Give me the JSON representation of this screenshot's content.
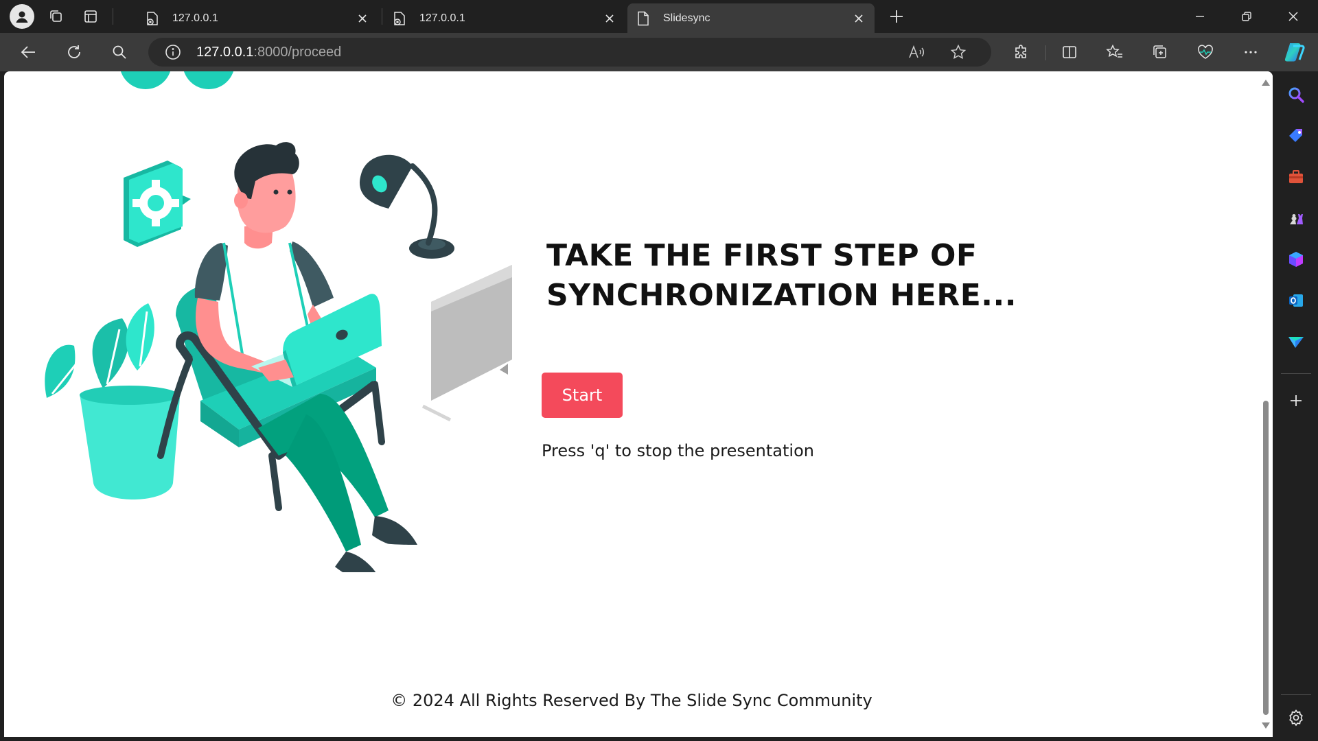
{
  "browser": {
    "tabs": [
      {
        "title": "127.0.0.1",
        "active": false
      },
      {
        "title": "127.0.0.1",
        "active": false
      },
      {
        "title": "Slidesync",
        "active": true
      }
    ],
    "address": {
      "host": "127.0.0.1",
      "rest": ":8000/proceed"
    },
    "icons": {
      "profile": "profile-icon",
      "workspaces": "workspaces-icon",
      "tab_actions": "tab-actions-icon",
      "new_tab": "plus-icon",
      "back": "back-arrow-icon",
      "refresh": "refresh-icon",
      "search": "search-icon",
      "read_aloud": "read-aloud-icon",
      "favorite": "star-icon",
      "extensions": "puzzle-icon",
      "split_screen": "split-screen-icon",
      "favorites": "favorites-icon",
      "collections": "collections-icon",
      "health": "heartbeat-icon",
      "more": "ellipsis-icon",
      "copilot": "copilot-icon"
    }
  },
  "page": {
    "heading": "TAKE THE FIRST STEP OF SYNCHRONIZATION HERE...",
    "start_label": "Start",
    "hint": "Press 'q' to stop the presentation",
    "footer": "© 2024 All Rights Reserved By The Slide Sync Community",
    "colors": {
      "accent": "#f44a5b",
      "teal": "#1ecfb7",
      "dark": "#2f4249"
    }
  },
  "sidebar": {
    "items": [
      "search-icon",
      "tag-icon",
      "toolbox-icon",
      "chess-icon",
      "office-icon",
      "outlook-icon",
      "send-icon"
    ],
    "add": "plus-icon",
    "settings": "gear-icon"
  }
}
